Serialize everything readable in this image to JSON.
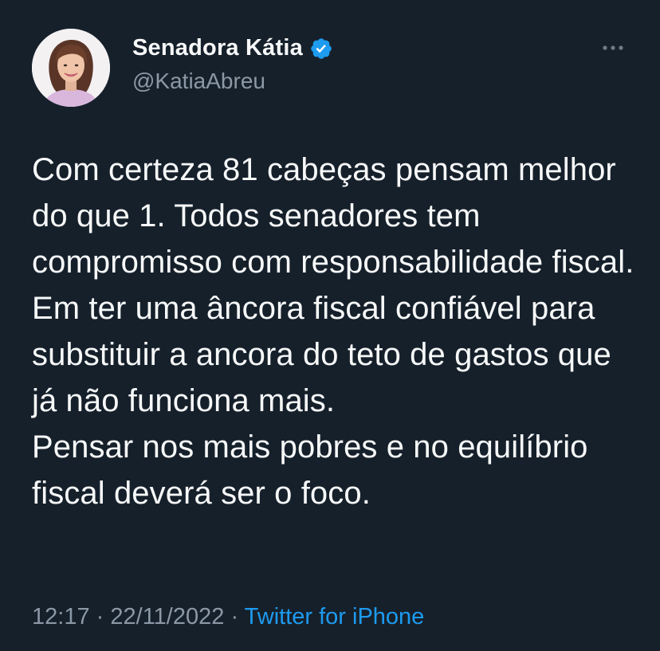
{
  "author": {
    "display_name": "Senadora Kátia",
    "handle": "@KatiaAbreu",
    "verified": true,
    "avatar_icon": "profile-photo"
  },
  "more_icon": "more-horizontal-icon",
  "tweet": {
    "line_1": "Com certeza 81 cabeças pensam melhor do que 1. Todos senadores tem compromisso com responsabilidade fiscal. Em ter uma âncora fiscal confiável para substituir a ancora do teto de gastos que já não funciona mais.",
    "line_2": "Pensar nos mais pobres e no equilíbrio fiscal deverá ser o foco."
  },
  "meta": {
    "time": "12:17",
    "separator_1": "·",
    "date": "22/11/2022",
    "separator_2": "·",
    "source": "Twitter for iPhone"
  },
  "colors": {
    "background": "#16202b",
    "text": "#f7f9f9",
    "muted": "#8b98a5",
    "accent": "#1d9bf0"
  }
}
